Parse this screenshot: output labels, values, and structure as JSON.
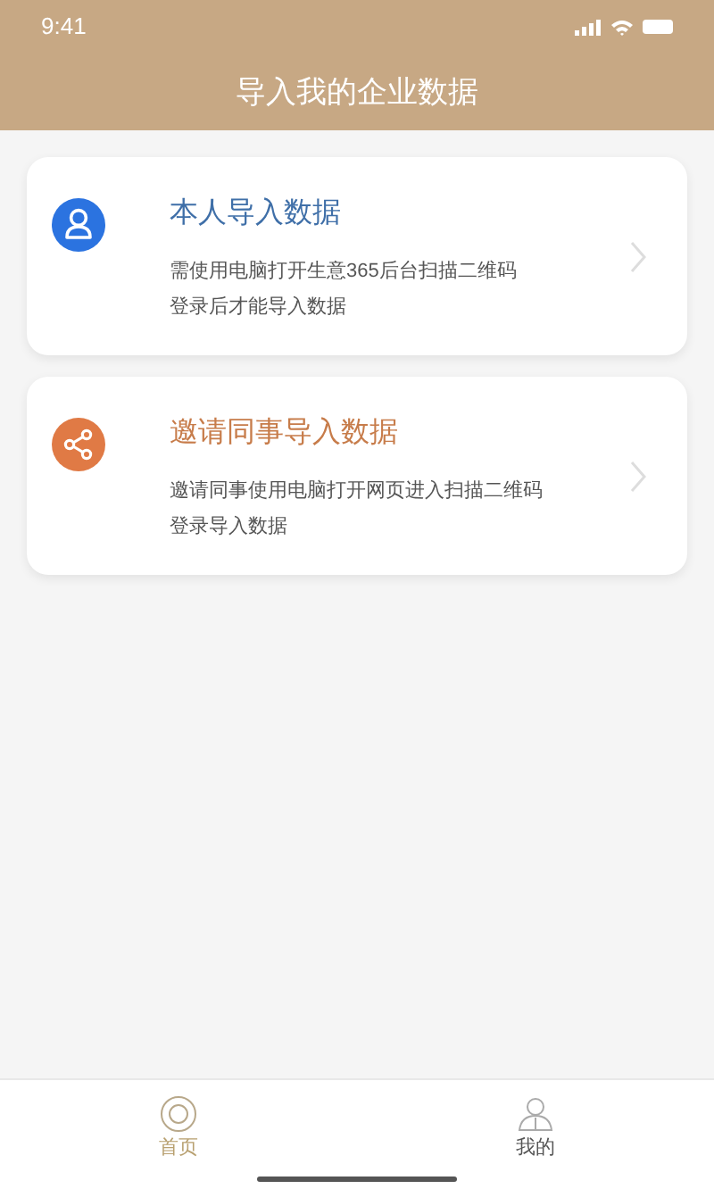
{
  "status_bar": {
    "time": "9:41"
  },
  "header": {
    "title": "导入我的企业数据"
  },
  "cards": [
    {
      "kind": "person",
      "color": "#2b73e0",
      "title": "本人导入数据",
      "lines": [
        "需使用电脑打开生意365后台扫描二维码",
        "登录后才能导入数据"
      ]
    },
    {
      "kind": "share",
      "color": "#e07a45",
      "title": "邀请同事导入数据",
      "lines": [
        "邀请同事使用电脑打开网页进入扫描二维码",
        "登录导入数据"
      ]
    }
  ],
  "tab_bar": [
    {
      "kind": "home",
      "label": "首页",
      "selected": true
    },
    {
      "kind": "profile",
      "label": "我的",
      "selected": false
    }
  ]
}
